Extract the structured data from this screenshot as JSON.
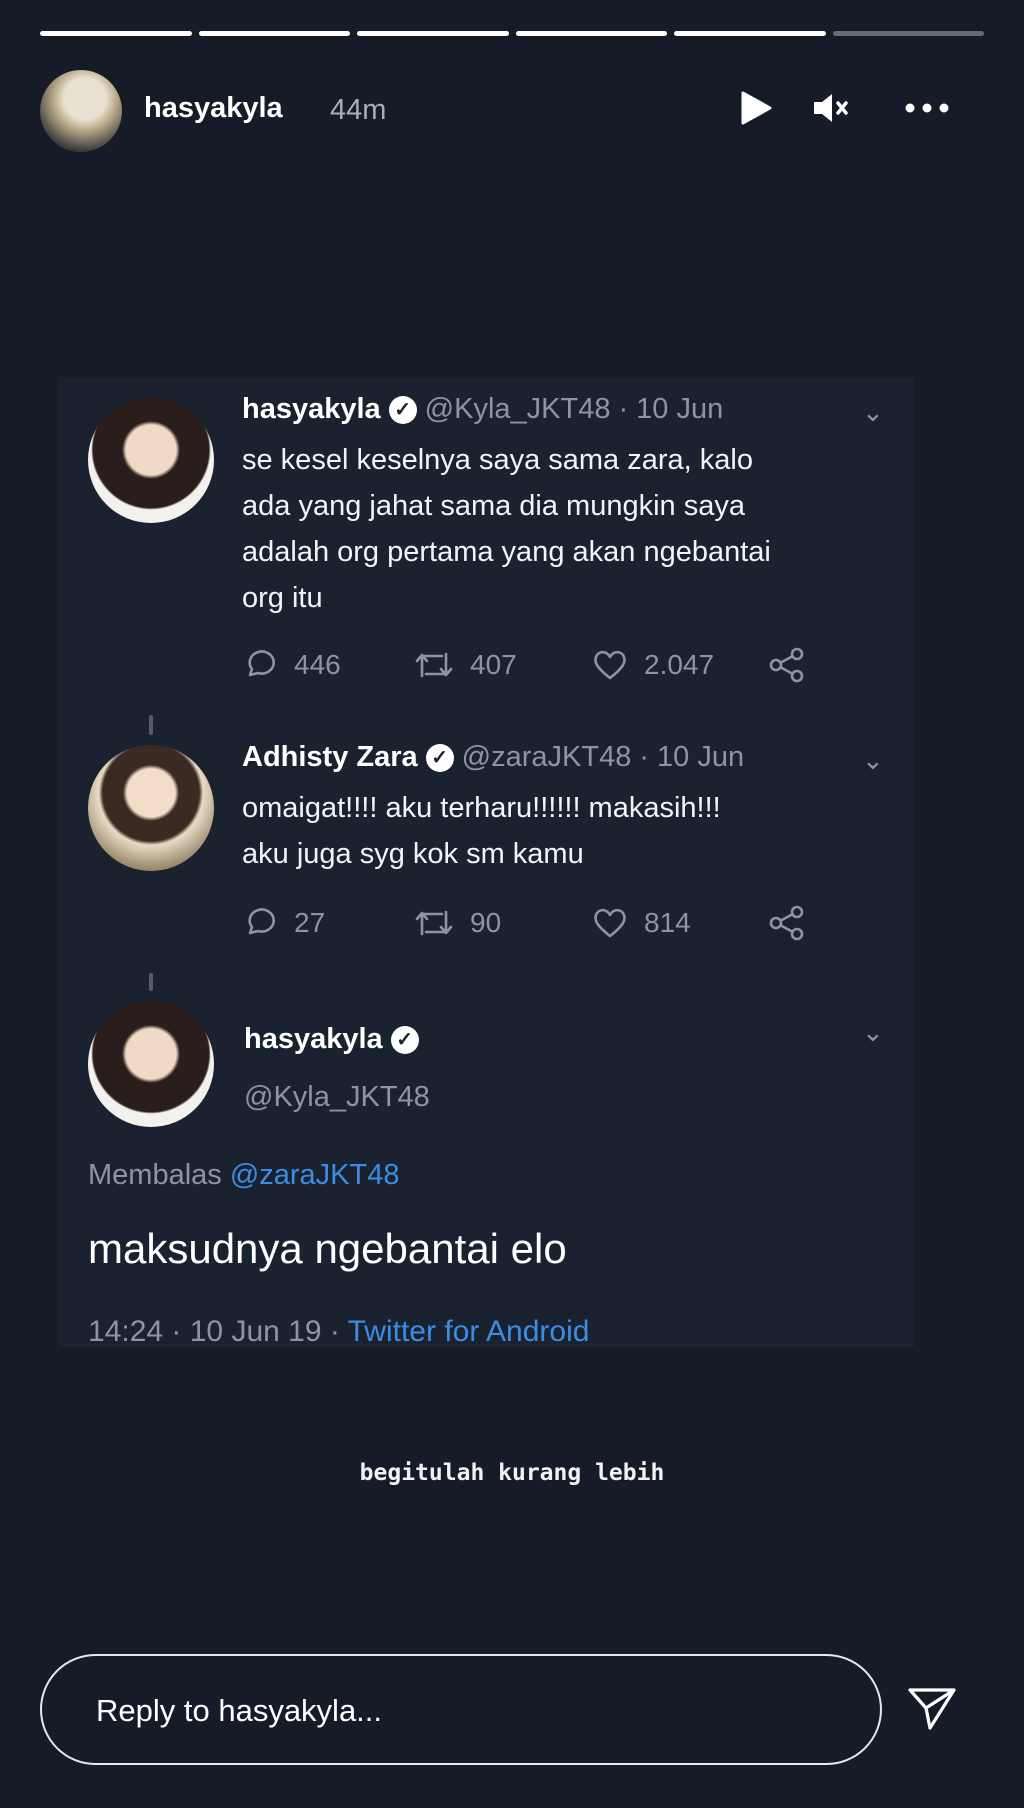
{
  "story": {
    "progress": [
      1,
      1,
      1,
      1,
      1,
      0
    ],
    "username": "hasyakyla",
    "time": "44m",
    "icons": {
      "play": "play-icon",
      "mute": "muted-speaker-icon",
      "more": "more-horizontal-icon"
    }
  },
  "tweet1": {
    "name": "hasyakyla",
    "handle": "@Kyla_JKT48",
    "date": "· 10 Jun",
    "text_lines": [
      "se kesel keselnya saya sama zara, kalo",
      "ada yang jahat sama dia mungkin saya",
      "adalah org pertama yang akan ngebantai",
      "org itu"
    ],
    "replies": "446",
    "retweets": "407",
    "likes": "2.047"
  },
  "tweet2": {
    "name": "Adhisty Zara",
    "handle": "@zaraJKT48",
    "date": "· 10 Jun",
    "text_lines": [
      "omaigat!!!! aku terharu!!!!!! makasih!!!",
      "aku juga syg kok sm kamu"
    ],
    "replies": "27",
    "retweets": "90",
    "likes": "814"
  },
  "tweet3": {
    "name": "hasyakyla",
    "handle": "@Kyla_JKT48",
    "reply_prefix": "Membalas ",
    "reply_handle": "@zaraJKT48",
    "text": "maksudnya ngebantai elo",
    "timestamp": "14:24 · 10 Jun 19 · ",
    "source": "Twitter for Android"
  },
  "caption": "begitulah kurang lebih",
  "reply": {
    "placeholder": "Reply to hasyakyla..."
  },
  "colors": {
    "background": "#151c28",
    "card": "#1a2230",
    "link": "#3b8de4",
    "muted": "#8c95a3"
  }
}
